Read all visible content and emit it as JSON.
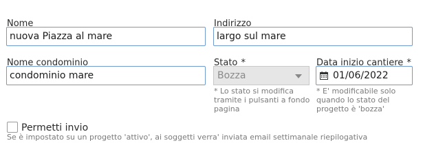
{
  "form": {
    "name": {
      "label": "Nome",
      "value": "nuova Piazza al mare"
    },
    "address": {
      "label": "Indirizzo",
      "value": "largo sul mare"
    },
    "condo": {
      "label": "Nome condominio",
      "value": "condominio mare"
    },
    "status": {
      "label": "Stato",
      "required_mark": "*",
      "value": "Bozza",
      "hint_lines": [
        "* Lo stato si modifica",
        "tramite i pulsanti a fondo",
        "pagina"
      ]
    },
    "start_date": {
      "label": "Data inizio cantiere",
      "required_mark": "*",
      "value": "01/06/2022",
      "hint_lines": [
        "* E' modificabile solo",
        "quando lo stato del",
        "progetto è 'bozza'"
      ]
    },
    "allow_send": {
      "label": "Permetti invio",
      "checked": false,
      "description": "Se è impostato su un progetto 'attivo', ai soggetti verra' inviata email settimanale riepilogativa"
    }
  },
  "icons": {
    "date": "calendar-icon",
    "dropdown": "chevron-down-icon"
  }
}
